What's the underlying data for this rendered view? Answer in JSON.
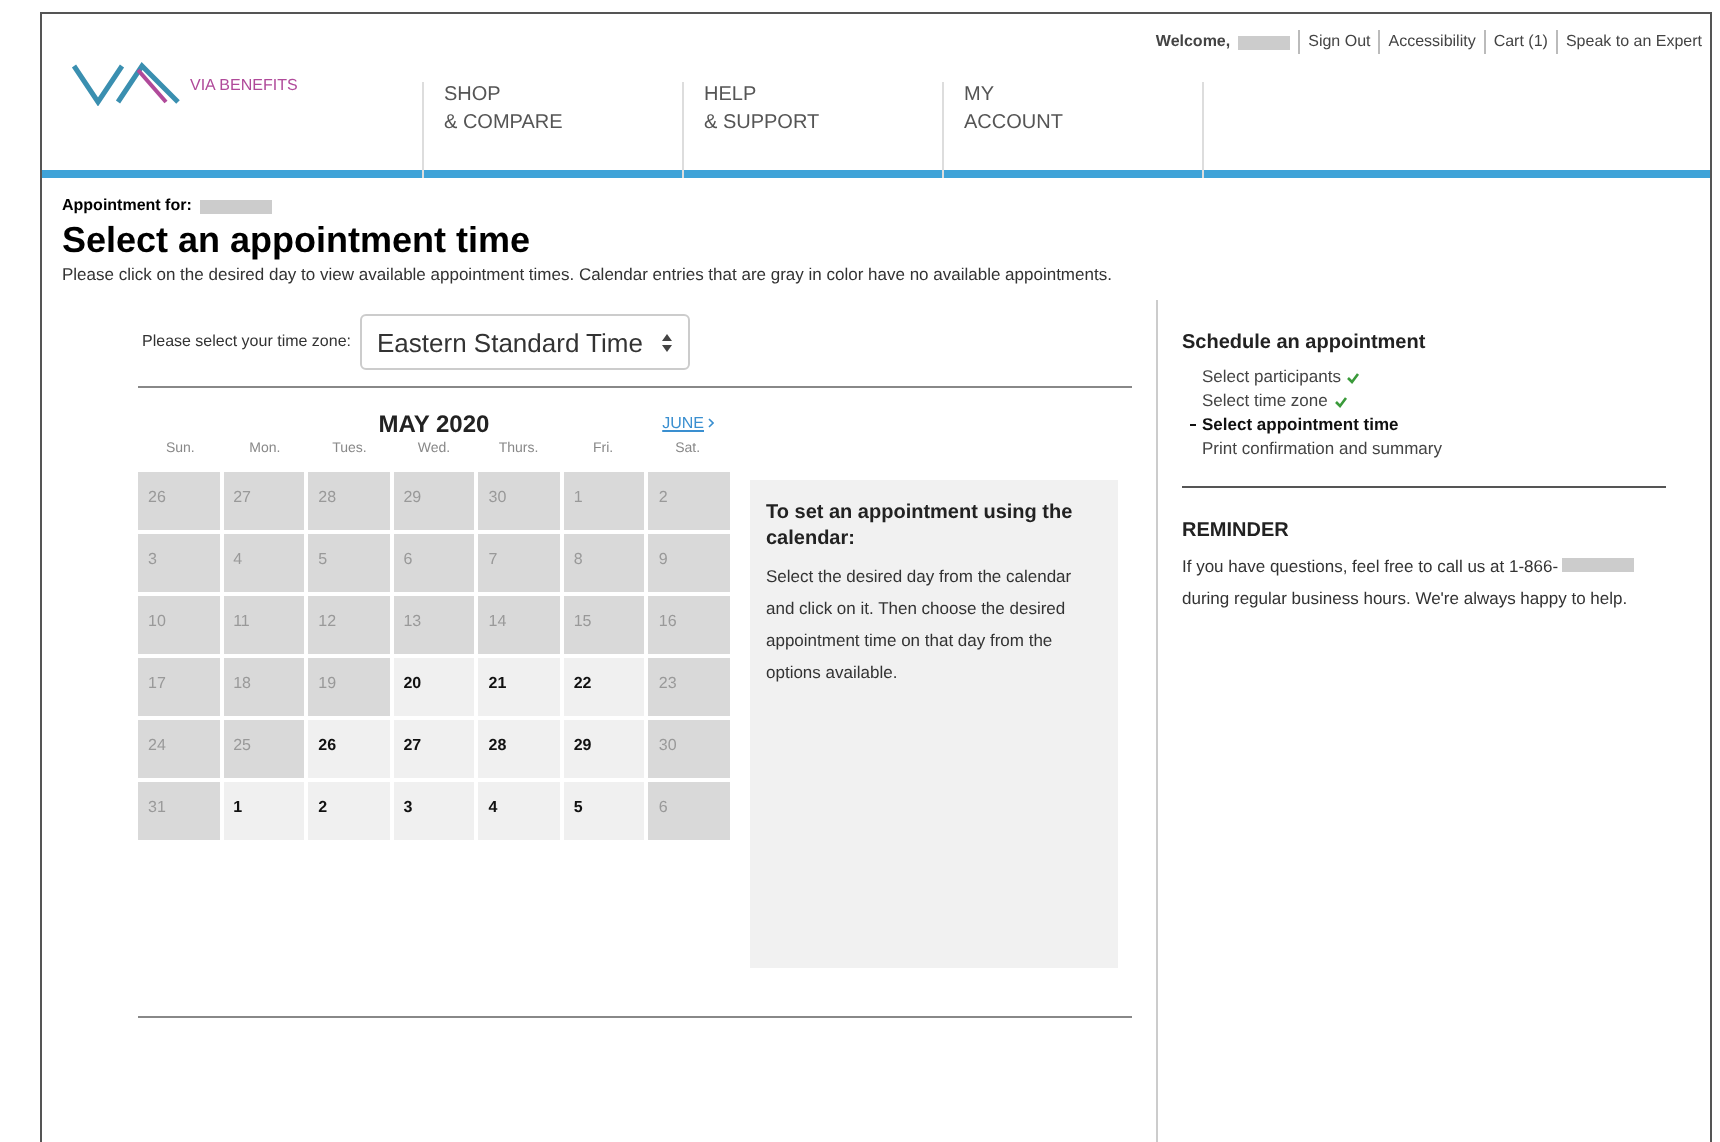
{
  "header": {
    "logo": "VIA BENEFITS",
    "welcome": "Welcome,",
    "links": [
      "Sign Out",
      "Accessibility",
      "Cart (1)",
      "Speak to an Expert"
    ],
    "nav": [
      {
        "line1": "SHOP",
        "line2": "& COMPARE"
      },
      {
        "line1": "HELP",
        "line2": "& SUPPORT"
      },
      {
        "line1": "MY",
        "line2": "ACCOUNT"
      }
    ]
  },
  "appointment_for": "Appointment for:",
  "title": "Select an appointment time",
  "intro": "Please click on the desired day to view available appointment times. Calendar entries that are gray in color have no available appointments.",
  "timezone": {
    "label": "Please select your time zone:",
    "value": "Eastern Standard Time"
  },
  "calendar": {
    "month": "MAY 2020",
    "next": "JUNE",
    "weekdays": [
      "Sun.",
      "Mon.",
      "Tues.",
      "Wed.",
      "Thurs.",
      "Fri.",
      "Sat."
    ],
    "weeks": [
      [
        {
          "day": "26",
          "available": false
        },
        {
          "day": "27",
          "available": false
        },
        {
          "day": "28",
          "available": false
        },
        {
          "day": "29",
          "available": false
        },
        {
          "day": "30",
          "available": false
        },
        {
          "day": "1",
          "available": false
        },
        {
          "day": "2",
          "available": false
        }
      ],
      [
        {
          "day": "3",
          "available": false
        },
        {
          "day": "4",
          "available": false
        },
        {
          "day": "5",
          "available": false
        },
        {
          "day": "6",
          "available": false
        },
        {
          "day": "7",
          "available": false
        },
        {
          "day": "8",
          "available": false
        },
        {
          "day": "9",
          "available": false
        }
      ],
      [
        {
          "day": "10",
          "available": false
        },
        {
          "day": "11",
          "available": false
        },
        {
          "day": "12",
          "available": false
        },
        {
          "day": "13",
          "available": false
        },
        {
          "day": "14",
          "available": false
        },
        {
          "day": "15",
          "available": false
        },
        {
          "day": "16",
          "available": false
        }
      ],
      [
        {
          "day": "17",
          "available": false
        },
        {
          "day": "18",
          "available": false
        },
        {
          "day": "19",
          "available": false
        },
        {
          "day": "20",
          "available": true
        },
        {
          "day": "21",
          "available": true
        },
        {
          "day": "22",
          "available": true
        },
        {
          "day": "23",
          "available": false
        }
      ],
      [
        {
          "day": "24",
          "available": false
        },
        {
          "day": "25",
          "available": false
        },
        {
          "day": "26",
          "available": true
        },
        {
          "day": "27",
          "available": true
        },
        {
          "day": "28",
          "available": true
        },
        {
          "day": "29",
          "available": true
        },
        {
          "day": "30",
          "available": false
        }
      ],
      [
        {
          "day": "31",
          "available": false
        },
        {
          "day": "1",
          "available": true
        },
        {
          "day": "2",
          "available": true
        },
        {
          "day": "3",
          "available": true
        },
        {
          "day": "4",
          "available": true
        },
        {
          "day": "5",
          "available": true
        },
        {
          "day": "6",
          "available": false
        }
      ]
    ]
  },
  "help": {
    "title": "To set an appointment using the calendar:",
    "text": "Select the desired day from the calendar and click on it. Then choose the desired appointment time on that day from the options available."
  },
  "steps": {
    "title": "Schedule an appointment",
    "items": [
      {
        "label": "Select participants",
        "done": true,
        "current": false
      },
      {
        "label": "Select time zone",
        "done": true,
        "current": false
      },
      {
        "label": "Select appointment time",
        "done": false,
        "current": true
      },
      {
        "label": "Print confirmation and summary",
        "done": false,
        "current": false
      }
    ]
  },
  "reminder": {
    "title": "REMINDER",
    "before": "If you have questions, feel free to call us at 1-866-",
    "after": "during regular business hours. We're always happy to help."
  }
}
